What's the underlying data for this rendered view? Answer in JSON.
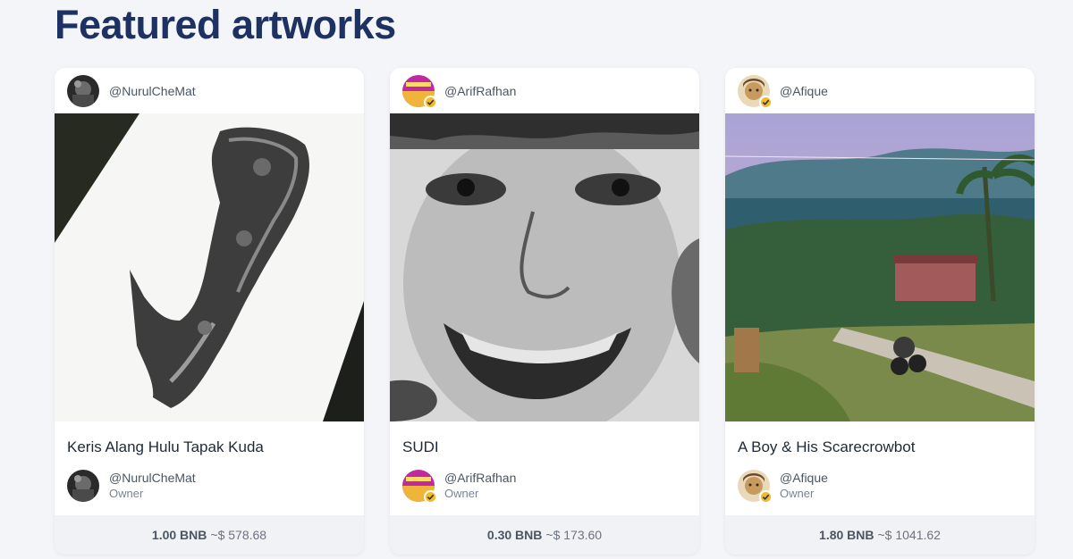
{
  "section": {
    "title": "Featured artworks"
  },
  "cards": [
    {
      "creator": "@NurulCheMat",
      "creator_verified": false,
      "title": "Keris Alang Hulu Tapak Kuda",
      "owner": "@NurulCheMat",
      "owner_role": "Owner",
      "price_bnb": "1.00 BNB",
      "price_usd": "~$ 578.68"
    },
    {
      "creator": "@ArifRafhan",
      "creator_verified": true,
      "title": "SUDI",
      "owner": "@ArifRafhan",
      "owner_role": "Owner",
      "price_bnb": "0.30 BNB",
      "price_usd": "~$ 173.60"
    },
    {
      "creator": "@Afique",
      "creator_verified": true,
      "title": "A Boy & His Scarecrowbot",
      "owner": "@Afique",
      "owner_role": "Owner",
      "price_bnb": "1.80 BNB",
      "price_usd": "~$ 1041.62"
    }
  ],
  "colors": {
    "title": "#1e3163",
    "verified": "#f5b921",
    "background": "#f4f5f8"
  }
}
